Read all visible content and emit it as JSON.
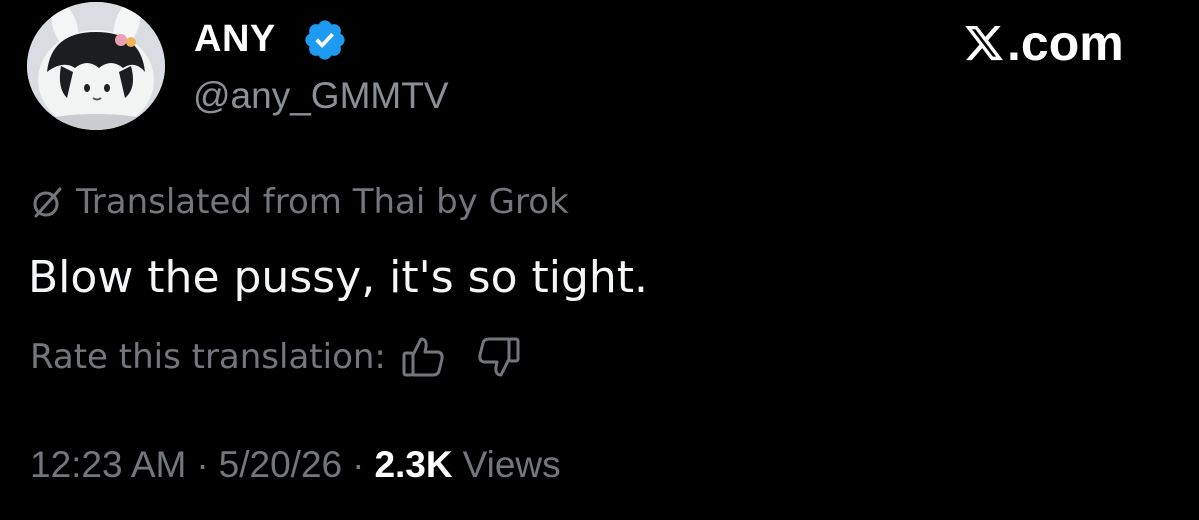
{
  "author": {
    "display_name": "ANY",
    "handle": "@any_GMMTV",
    "verified": true,
    "avatar_icon": "plush-bunny-avatar"
  },
  "brand": {
    "suffix": ".com",
    "icon": "x-logo-icon"
  },
  "translation": {
    "notice": "Translated from Thai by Grok",
    "icon": "grok-icon"
  },
  "tweet": {
    "text": "Blow the pussy, it's so tight."
  },
  "rating": {
    "prompt": "Rate this translation:",
    "up_icon": "thumbs-up-icon",
    "down_icon": "thumbs-down-icon"
  },
  "meta": {
    "time": "12:23 AM",
    "separator": "·",
    "date": "5/20/26",
    "views_count": "2.3K",
    "views_label": "Views"
  },
  "colors": {
    "background": "#000000",
    "verified_badge": "#1d9bf0",
    "secondary_text": "#73777c",
    "primary_text": "#ffffff"
  }
}
